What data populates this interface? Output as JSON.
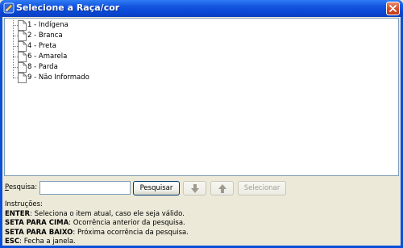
{
  "window": {
    "title": "Selecione a Raça/cor",
    "title_icon": "pencil-icon",
    "close_icon": "close-icon",
    "titlebar_color": "#0a48d6",
    "close_color": "#d7502a"
  },
  "tree": {
    "items": [
      {
        "label": "1 - Indígena",
        "icon": "document-icon"
      },
      {
        "label": "2 - Branca",
        "icon": "document-icon"
      },
      {
        "label": "4 - Preta",
        "icon": "document-icon"
      },
      {
        "label": "6 - Amarela",
        "icon": "document-icon"
      },
      {
        "label": "8 - Parda",
        "icon": "document-icon"
      },
      {
        "label": "9 - Não Informado",
        "icon": "document-icon"
      }
    ]
  },
  "search": {
    "label_prefix": "P",
    "label_rest": "esquisa:",
    "value": "",
    "search_button": "Pesquisar",
    "down_icon": "arrow-down-icon",
    "up_icon": "arrow-up-icon",
    "select_button": "Selecionar"
  },
  "instructions": {
    "heading": "Instruções:",
    "lines": [
      {
        "key": "ENTER",
        "text": ": Seleciona o item atual, caso ele seja válido."
      },
      {
        "key": "SETA PARA CIMA",
        "text": ": Ocorrência anterior da pesquisa."
      },
      {
        "key": "SETA PARA BAIXO",
        "text": ": Próxima ocorrência da pesquisa."
      },
      {
        "key": "ESC",
        "text": ": Fecha a janela."
      }
    ]
  }
}
